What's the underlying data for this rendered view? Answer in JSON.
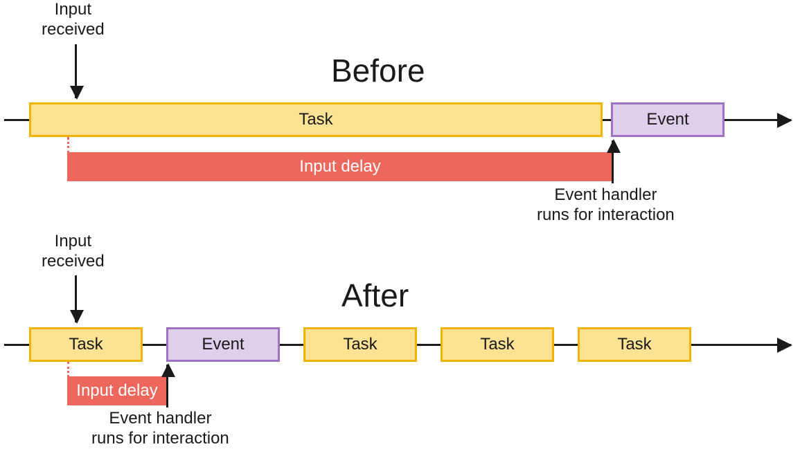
{
  "titles": {
    "before": "Before",
    "after": "After"
  },
  "labels": {
    "input_received": "Input\nreceived",
    "event_handler": "Event handler\nruns for interaction"
  },
  "colors": {
    "task_fill": "#fde293",
    "task_border": "#f0b400",
    "event_fill": "#e0cfea",
    "event_border": "#9d72c3",
    "delay_fill": "#ee675c",
    "ink": "#1a1a1a"
  },
  "before": {
    "task": "Task",
    "event": "Event",
    "delay": "Input delay"
  },
  "after": {
    "tasks": [
      "Task",
      "Task",
      "Task",
      "Task"
    ],
    "event": "Event",
    "delay": "Input delay"
  }
}
